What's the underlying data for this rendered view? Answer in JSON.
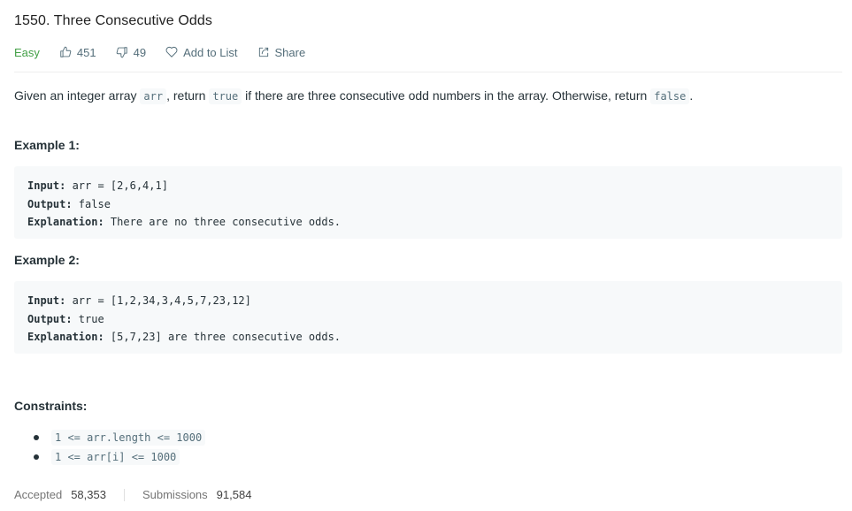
{
  "problem": {
    "title": "1550. Three Consecutive Odds",
    "difficulty": "Easy",
    "likes": "451",
    "dislikes": "49",
    "add_to_list": "Add to List",
    "share": "Share"
  },
  "description": {
    "part1": "Given an integer array ",
    "code1": "arr",
    "part2": ", return ",
    "code2": "true",
    "part3": " if there are three consecutive odd numbers in the array. Otherwise, return ",
    "code3": "false",
    "part4": "."
  },
  "examples": [
    {
      "heading": "Example 1:",
      "input_label": "Input:",
      "input": " arr = [2,6,4,1]",
      "output_label": "Output:",
      "output": " false",
      "explanation_label": "Explanation:",
      "explanation": " There are no three consecutive odds."
    },
    {
      "heading": "Example 2:",
      "input_label": "Input:",
      "input": " arr = [1,2,34,3,4,5,7,23,12]",
      "output_label": "Output:",
      "output": " true",
      "explanation_label": "Explanation:",
      "explanation": " [5,7,23] are three consecutive odds."
    }
  ],
  "constraints": {
    "heading": "Constraints:",
    "items": [
      "1 <= arr.length <= 1000",
      "1 <= arr[i] <= 1000"
    ]
  },
  "stats": {
    "accepted_label": "Accepted",
    "accepted_value": "58,353",
    "submissions_label": "Submissions",
    "submissions_value": "91,584"
  },
  "colors": {
    "easy": "#43a047",
    "meta": "#546e7a",
    "code_bg": "#f7f9fa"
  }
}
